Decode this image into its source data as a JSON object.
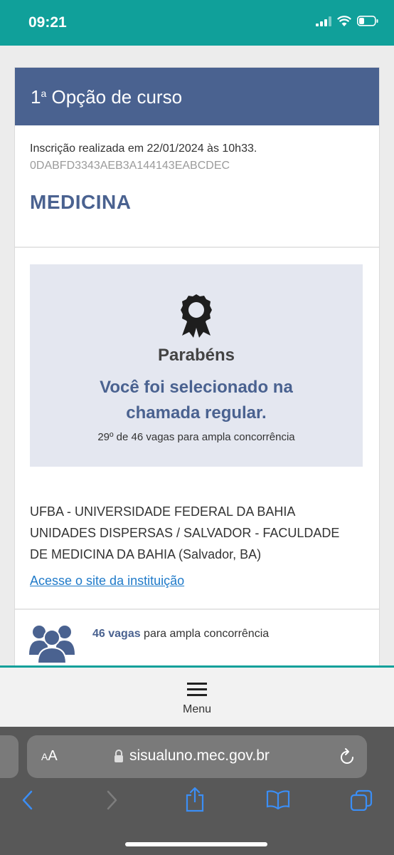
{
  "status": {
    "time": "09:21"
  },
  "card": {
    "header_prefix": "1",
    "header_sup": "a",
    "header_rest": " Opção de curso",
    "inscricao": "Inscrição realizada em 22/01/2024 às 10h33.",
    "codigo": "0DABFD3343AEB3A144143EABCDEC",
    "curso": "MEDICINA"
  },
  "resultado": {
    "titulo": "Parabéns",
    "mensagem_linha1": "Você foi selecionado na",
    "mensagem_linha2": "chamada regular.",
    "posicao": "29º de 46 vagas para ampla concorrência"
  },
  "instituicao": {
    "nome_linha1": "UFBA - UNIVERSIDADE FEDERAL DA BAHIA",
    "nome_linha2": "UNIDADES DISPERSAS / SALVADOR - FACULDADE",
    "nome_linha3": "DE MEDICINA DA BAHIA (Salvador, BA)",
    "link": "Acesse o site da instituição"
  },
  "vagas": {
    "numero": "46 vagas",
    "texto": " para ampla concorrência"
  },
  "menu": {
    "label": "Menu"
  },
  "browser": {
    "aa_small": "A",
    "aa_big": "A",
    "url": "sisualuno.mec.gov.br"
  },
  "colors": {
    "teal": "#10a09a",
    "brand_blue": "#4a6290",
    "link_blue": "#1f7ac9"
  }
}
